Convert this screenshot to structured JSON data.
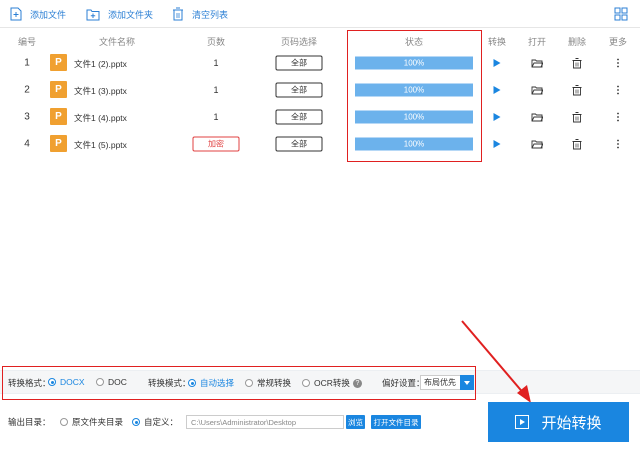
{
  "toolbar": {
    "add_file": "添加文件",
    "add_folder": "添加文件夹",
    "clear_list": "清空列表"
  },
  "table": {
    "headers": [
      "编号",
      "文件名称",
      "页数",
      "页码选择",
      "状态",
      "转换",
      "打开",
      "删除",
      "更多"
    ],
    "rows": [
      {
        "index": "1",
        "icon": "P",
        "name": "文件1 (2).pptx",
        "pages": "1",
        "range": "全部",
        "progress": 1.0,
        "status": "100%"
      },
      {
        "index": "2",
        "icon": "P",
        "name": "文件1 (3).pptx",
        "pages": "1",
        "range": "全部",
        "progress": 1.0,
        "status": "100%"
      },
      {
        "index": "3",
        "icon": "P",
        "name": "文件1 (4).pptx",
        "pages": "1",
        "range": "全部",
        "progress": 1.0,
        "status": "100%"
      },
      {
        "index": "4",
        "icon": "P",
        "name": "文件1 (5).pptx",
        "pages": "加密",
        "range": "全部",
        "progress": 1.0,
        "status": "100%"
      }
    ]
  },
  "options": {
    "format_label": "转换格式：",
    "format_docx": "DOCX",
    "format_doc": "DOC",
    "mode_label": "转换模式：",
    "mode_auto": "自动选择",
    "mode_normal": "常规转换",
    "mode_ocr": "OCR转换",
    "help": "?",
    "pref_label": "偏好设置：",
    "pref_value": "布局优先"
  },
  "output": {
    "label": "输出目录：",
    "original": "原文件夹目录",
    "custom": "自定义：",
    "path": "C:\\Users\\Administrator\\Desktop",
    "browse": "浏览",
    "open_folder": "打开文件目录"
  },
  "start_button": "开始转换",
  "colors": {
    "accent": "#1a86e0",
    "progress": "#6cb2ec",
    "highlight": "#e02020",
    "ppt_icon": "#f0a030"
  }
}
